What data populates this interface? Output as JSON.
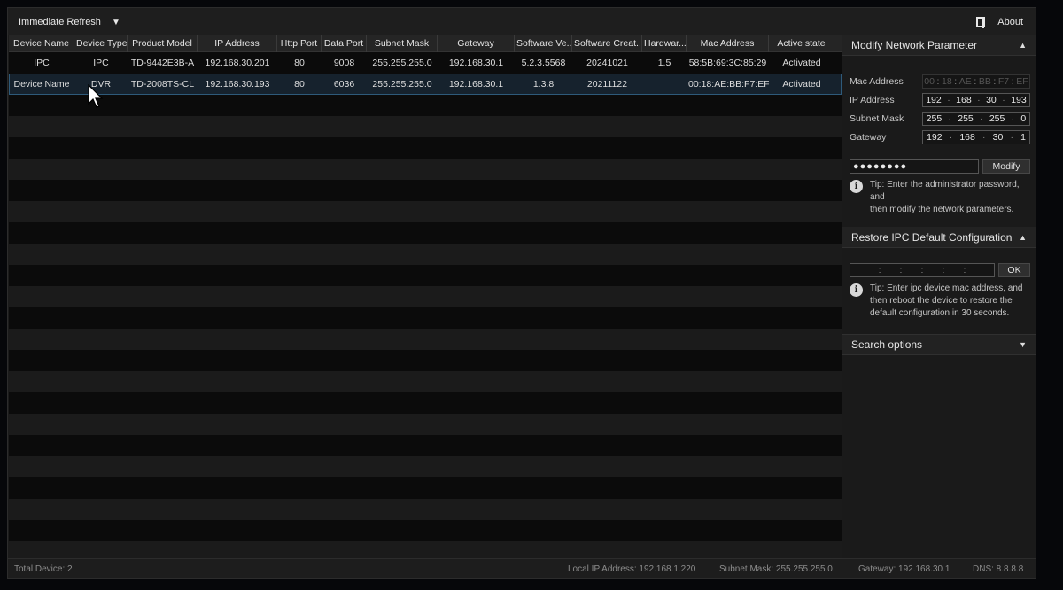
{
  "toolbar": {
    "refresh_label": "Immediate Refresh",
    "about_label": "About"
  },
  "table": {
    "columns": [
      {
        "label": "Device Name",
        "w": 74
      },
      {
        "label": "Device Type",
        "w": 60
      },
      {
        "label": "Product Model",
        "w": 79
      },
      {
        "label": "IP Address",
        "w": 90
      },
      {
        "label": "Http Port",
        "w": 50
      },
      {
        "label": "Data Port",
        "w": 51
      },
      {
        "label": "Subnet Mask",
        "w": 80
      },
      {
        "label": "Gateway",
        "w": 87
      },
      {
        "label": "Software Ve...",
        "w": 65
      },
      {
        "label": "Software Creat...",
        "w": 79
      },
      {
        "label": "Hardwar...",
        "w": 50
      },
      {
        "label": "Mac Address",
        "w": 93
      },
      {
        "label": "Active state",
        "w": 74
      }
    ],
    "rows": [
      [
        "IPC",
        "IPC",
        "TD-9442E3B-A",
        "192.168.30.201",
        "80",
        "9008",
        "255.255.255.0",
        "192.168.30.1",
        "5.2.3.5568",
        "20241021",
        "1.5",
        "58:5B:69:3C:85:29",
        "Activated"
      ],
      [
        "Device Name",
        "DVR",
        "TD-2008TS-CL",
        "192.168.30.193",
        "80",
        "6036",
        "255.255.255.0",
        "192.168.30.1",
        "1.3.8",
        "20211122",
        "",
        "00:18:AE:BB:F7:EF",
        "Activated"
      ]
    ],
    "selected_row": 1,
    "empty_rows": 22
  },
  "modify_panel": {
    "title": "Modify Network Parameter",
    "mac_label": "Mac Address",
    "mac_value": [
      "00",
      "18",
      "AE",
      "BB",
      "F7",
      "EF"
    ],
    "ip_label": "IP Address",
    "ip_value": [
      "192",
      "168",
      "30",
      "193"
    ],
    "mask_label": "Subnet Mask",
    "mask_value": [
      "255",
      "255",
      "255",
      "0"
    ],
    "gateway_label": "Gateway",
    "gateway_value": [
      "192",
      "168",
      "30",
      "1"
    ],
    "password_value": "●●●●●●●●",
    "modify_label": "Modify",
    "tip_line1": "Tip: Enter the administrator password,",
    "tip_line2": "and",
    "tip_line3": "then modify the network parameters."
  },
  "restore_panel": {
    "title": "Restore IPC Default Configuration",
    "ok_label": "OK",
    "tip_line1": "Tip: Enter ipc device mac address, and",
    "tip_line2": "then reboot the device to restore the",
    "tip_line3": "default configuration in 30 seconds."
  },
  "search_panel": {
    "title": "Search options"
  },
  "status": {
    "total": "Total Device: 2",
    "local_ip": "Local IP Address: 192.168.1.220",
    "subnet": "Subnet Mask: 255.255.255.0",
    "gateway": "Gateway: 192.168.30.1",
    "dns": "DNS: 8.8.8.8"
  }
}
